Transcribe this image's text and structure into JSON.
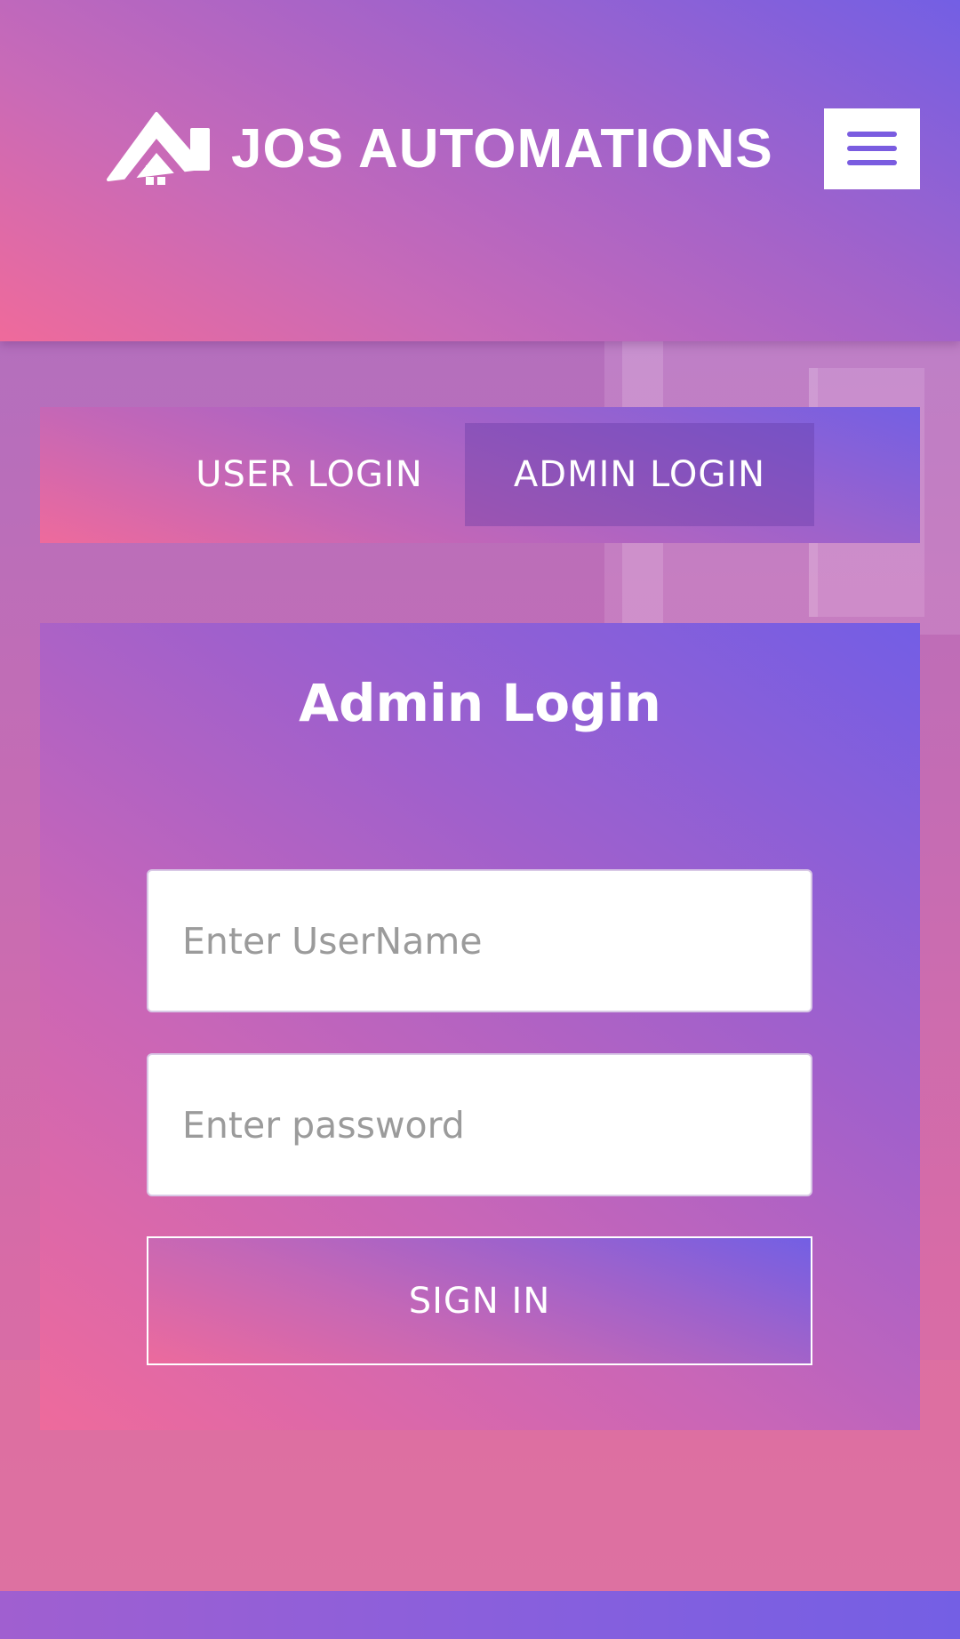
{
  "header": {
    "brand_name": "JOS AUTOMATIONS",
    "logo_icon": "house-roof-icon",
    "menu_icon": "hamburger-menu-icon"
  },
  "tabs": [
    {
      "label": "USER LOGIN",
      "active": false
    },
    {
      "label": "ADMIN LOGIN",
      "active": true
    }
  ],
  "login_card": {
    "title": "Admin Login",
    "username": {
      "value": "",
      "placeholder": "Enter UserName"
    },
    "password": {
      "value": "",
      "placeholder": "Enter password"
    },
    "submit_label": "SIGN IN"
  },
  "colors": {
    "gradient_pink": "#ef6a9b",
    "gradient_purple": "#a463c9",
    "gradient_blue_violet": "#735fe4",
    "menu_icon_color": "#7a5ce0"
  }
}
